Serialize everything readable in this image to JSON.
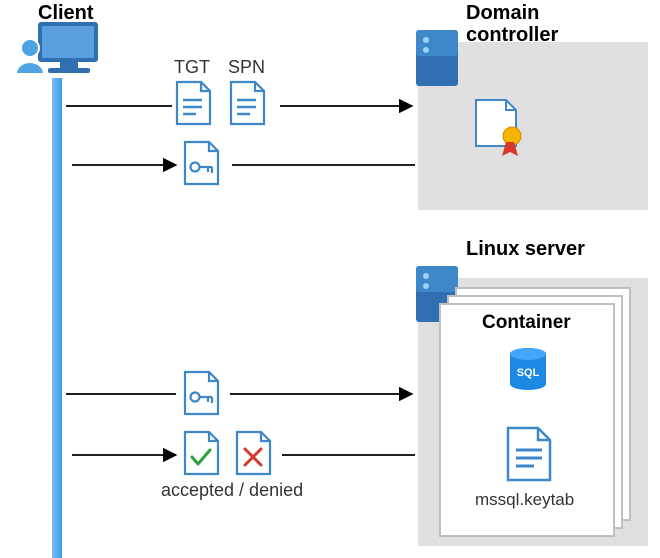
{
  "labels": {
    "client": "Client",
    "domain_controller_l1": "Domain",
    "domain_controller_l2": "controller",
    "linux_server": "Linux server",
    "container": "Container",
    "tgt": "TGT",
    "spn": "SPN",
    "accepted_denied": "accepted / denied",
    "keytab": "mssql.keytab",
    "sql_badge": "SQL"
  },
  "diagram": {
    "actors": [
      "Client",
      "Domain controller",
      "Linux server"
    ],
    "flows": [
      {
        "from": "Client",
        "to": "Domain controller",
        "payload": [
          "TGT",
          "SPN"
        ]
      },
      {
        "from": "Domain controller",
        "to": "Client",
        "payload": [
          "Service ticket (key)"
        ]
      },
      {
        "from": "Client",
        "to": "Linux server",
        "payload": [
          "Service ticket (key)"
        ]
      },
      {
        "from": "Linux server",
        "to": "Client",
        "payload": [
          "accepted",
          "denied"
        ]
      }
    ],
    "linux_server_contents": {
      "container": [
        "SQL",
        "mssql.keytab"
      ]
    }
  }
}
